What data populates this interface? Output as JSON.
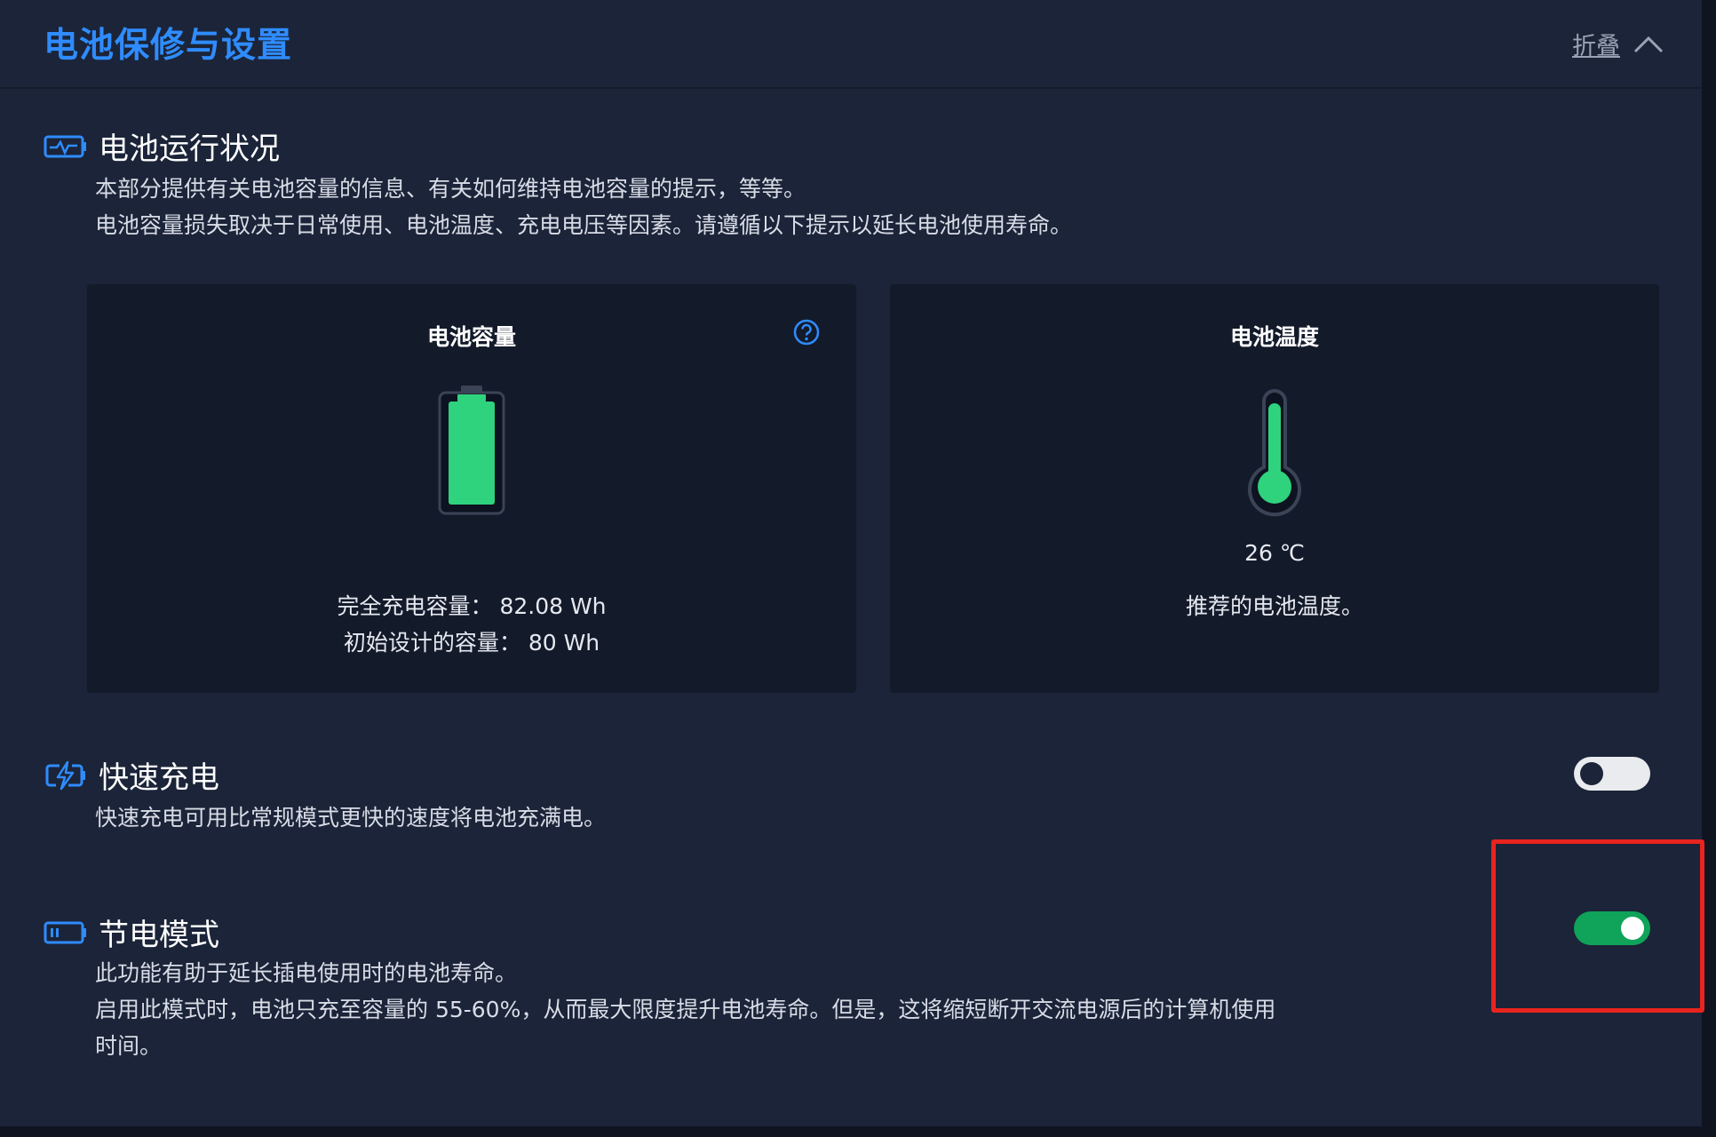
{
  "header": {
    "title": "电池保修与设置",
    "collapse_label": "折叠"
  },
  "battery_status": {
    "title": "电池运行状况",
    "desc_line1": "本部分提供有关电池容量的信息、有关如何维持电池容量的提示，等等。",
    "desc_line2": "电池容量损失取决于日常使用、电池温度、充电电压等因素。请遵循以下提示以延长电池使用寿命。"
  },
  "capacity_card": {
    "title": "电池容量",
    "full_charge_label": "完全充电容量：",
    "full_charge_value": "82.08 Wh",
    "design_label": "初始设计的容量：",
    "design_value": "80 Wh",
    "level_fraction": 1.0
  },
  "temperature_card": {
    "title": "电池温度",
    "value": "26 ℃",
    "status": "推荐的电池温度。"
  },
  "fast_charge": {
    "title": "快速充电",
    "desc": "快速充电可用比常规模式更快的速度将电池充满电。",
    "enabled": false
  },
  "power_saving": {
    "title": "节电模式",
    "desc_line1": "此功能有助于延长插电使用时的电池寿命。",
    "desc_line2": "启用此模式时，电池只充至容量的 55-60%，从而最大限度提升电池寿命。但是，这将缩短断开交流电源后的计算机使用",
    "desc_line3": "时间。",
    "enabled": true
  },
  "colors": {
    "accent": "#2f8cff",
    "battery_green": "#2fd27d",
    "toggle_on": "#10a35a",
    "highlight": "#e8241f"
  }
}
